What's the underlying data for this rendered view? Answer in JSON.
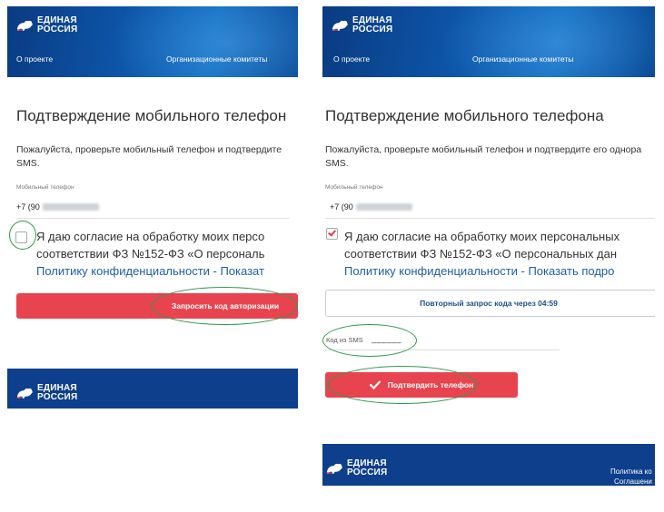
{
  "brand": {
    "line1": "ЕДИНАЯ",
    "line2": "РОССИЯ",
    "bear_color": "#ffffff",
    "primary_blue": "#0d3f8c",
    "accent_red": "#e8444f",
    "annotation_green": "#2f9a4a"
  },
  "nav": {
    "about": "О проекте",
    "committees": "Организационные комитеты"
  },
  "left": {
    "title": "Подтверждение мобильного телефон",
    "desc_line1": "Пожалуйста, проверьте мобильный телефон и подтвердите",
    "desc_line2": "SMS.",
    "phone_label": "Мобильный телефон",
    "phone_prefix": "+7 (90",
    "consent_line1": "Я даю согласие на обработку моих персо",
    "consent_line2": "соответствии ФЗ №152-ФЗ «О персональ",
    "consent_line3": "Политику конфиденциальности - Показат",
    "consent_checked": false,
    "request_button": "Запросить код авторизации"
  },
  "right": {
    "title": "Подтверждение мобильного телефона",
    "desc_line1": "Пожалуйста, проверьте мобильный телефон и подтвердите его однора",
    "desc_line2": "SMS.",
    "phone_label": "Мобильный телефон",
    "phone_prefix": "+7 (90",
    "consent_line1": "Я даю согласие на обработку моих персональных",
    "consent_line2": "соответствии ФЗ №152-ФЗ «О персональных дан",
    "consent_line3": "Политику конфиденциальности - Показать подро",
    "consent_checked": true,
    "resend_button": "Повторный запрос кода через 04:59",
    "sms_label": "Код из SMS",
    "sms_value": "______",
    "confirm_button": "Подтвердить телефон",
    "footer_link1": "Политика ко",
    "footer_link2": "Соглашени"
  }
}
